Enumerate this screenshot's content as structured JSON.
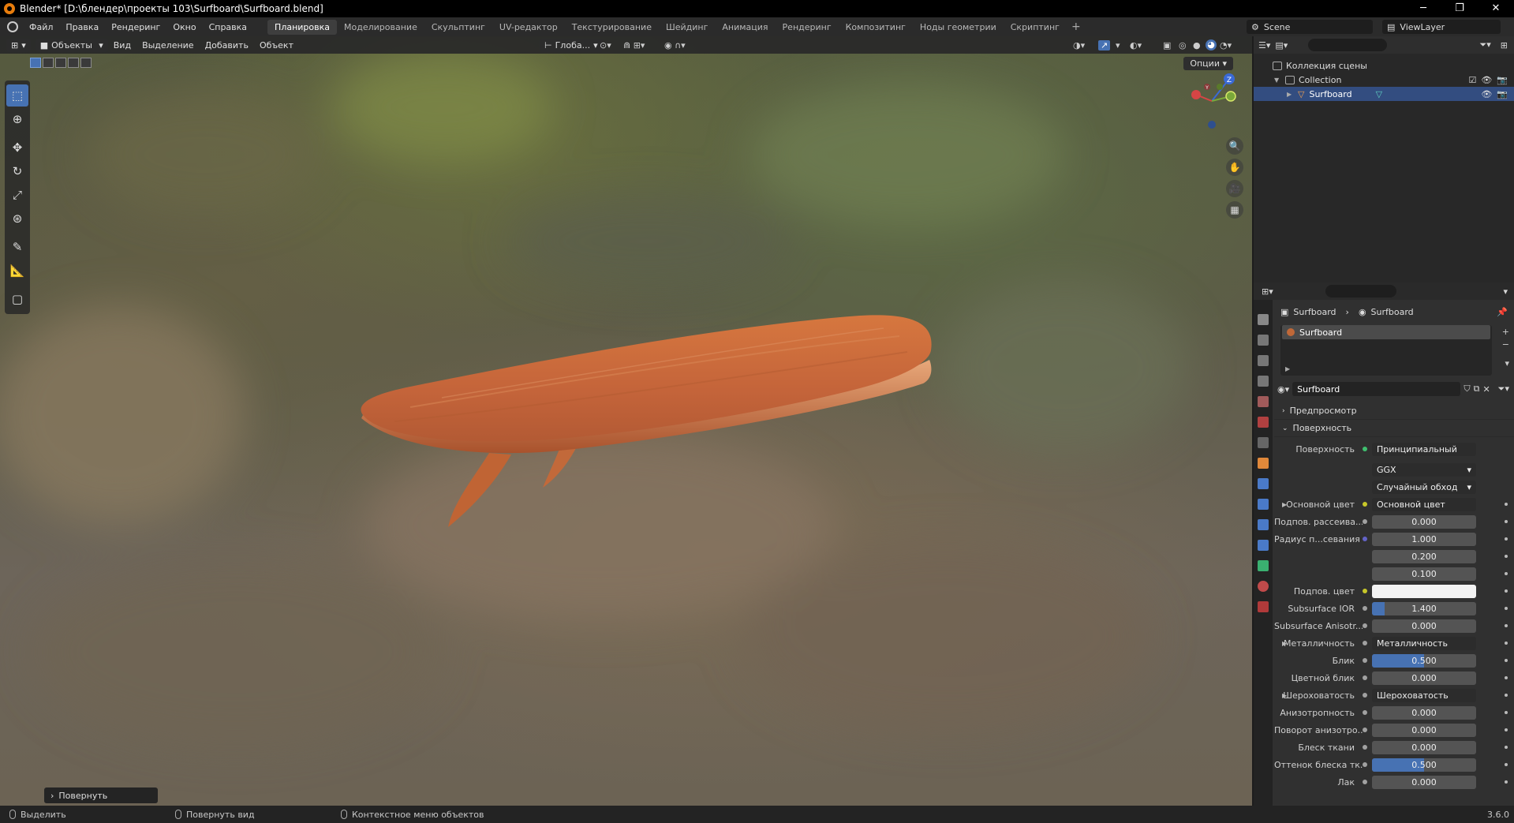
{
  "titlebar": {
    "title": "Blender* [D:\\блендер\\проекты 103\\Surfboard\\Surfboard.blend]",
    "minimize": "─",
    "maximize": "❐",
    "close": "✕"
  },
  "menubar": {
    "menus": [
      "Файл",
      "Правка",
      "Рендеринг",
      "Окно",
      "Справка"
    ],
    "workspaces": [
      "Планировка",
      "Моделирование",
      "Скульптинг",
      "UV-редактор",
      "Текстурирование",
      "Шейдинг",
      "Анимация",
      "Рендеринг",
      "Композитинг",
      "Ноды геометрии",
      "Скриптинг"
    ],
    "add_label": "+",
    "scene": "Scene",
    "view_layer": "ViewLayer"
  },
  "viewport": {
    "mode": "Объекты",
    "menus": [
      "Вид",
      "Выделение",
      "Добавить",
      "Объект"
    ],
    "orientation": "Глоба...",
    "options": "Опции",
    "gizmo": {
      "x": "X",
      "y": "Y",
      "z": "Z"
    }
  },
  "operator_panel": "Повернуть",
  "statusbar": {
    "select": "Выделить",
    "rotate_view": "Повернуть вид",
    "context_menu": "Контекстное меню объектов",
    "version": "3.6.0"
  },
  "outliner": {
    "scene_collection": "Коллекция сцены",
    "collection": "Collection",
    "object": "Surfboard"
  },
  "properties": {
    "breadcrumb": {
      "object": "Surfboard",
      "material": "Surfboard"
    },
    "slot": "Surfboard",
    "material_name": "Surfboard",
    "sections": {
      "preview": "Предпросмотр",
      "surface": "Поверхность"
    },
    "surface_label": "Поверхность",
    "surface_value": "Принципиальный BSDF",
    "distribution": "GGX",
    "subsurface_method": "Случайный обход",
    "rows": [
      {
        "label": "Основной цвет",
        "value": "Основной цвет",
        "kind": "link",
        "sock": "#c7c729",
        "expand": true
      },
      {
        "label": "Подпов. рассеива...",
        "value": "0.000",
        "kind": "num",
        "sock": "#a1a1a1",
        "fill": 0
      },
      {
        "label": "Радиус п...севания",
        "value": "1.000",
        "kind": "num",
        "sock": "#6363c7",
        "fill": 0
      },
      {
        "label": "",
        "value": "0.200",
        "kind": "num",
        "sock": "",
        "fill": 0
      },
      {
        "label": "",
        "value": "0.100",
        "kind": "num",
        "sock": "",
        "fill": 0
      },
      {
        "label": "Подпов. цвет",
        "value": "",
        "kind": "color",
        "sock": "#c7c729",
        "color": "#f2f2f2"
      },
      {
        "label": "Subsurface IOR",
        "value": "1.400",
        "kind": "num",
        "sock": "#a1a1a1",
        "fill": 0.12
      },
      {
        "label": "Subsurface Anisotr...",
        "value": "0.000",
        "kind": "num",
        "sock": "#a1a1a1",
        "fill": 0
      },
      {
        "label": "Металличность",
        "value": "Металличность",
        "kind": "link",
        "sock": "#a1a1a1",
        "expand": true
      },
      {
        "label": "Блик",
        "value": "0.500",
        "kind": "num",
        "sock": "#a1a1a1",
        "fill": 0.5
      },
      {
        "label": "Цветной блик",
        "value": "0.000",
        "kind": "num",
        "sock": "#a1a1a1",
        "fill": 0
      },
      {
        "label": "Шероховатость",
        "value": "Шероховатость",
        "kind": "link",
        "sock": "#a1a1a1",
        "expand": true
      },
      {
        "label": "Анизотропность",
        "value": "0.000",
        "kind": "num",
        "sock": "#a1a1a1",
        "fill": 0
      },
      {
        "label": "Поворот анизотро...",
        "value": "0.000",
        "kind": "num",
        "sock": "#a1a1a1",
        "fill": 0
      },
      {
        "label": "Блеск ткани",
        "value": "0.000",
        "kind": "num",
        "sock": "#a1a1a1",
        "fill": 0
      },
      {
        "label": "Оттенок блеска тк...",
        "value": "0.500",
        "kind": "num",
        "sock": "#a1a1a1",
        "fill": 0.5
      },
      {
        "label": "Лак",
        "value": "0.000",
        "kind": "num",
        "sock": "#a1a1a1",
        "fill": 0
      }
    ]
  },
  "colors": {
    "accent": "#4772b3",
    "selected_row": "#334d80",
    "board": "#c8683a"
  }
}
